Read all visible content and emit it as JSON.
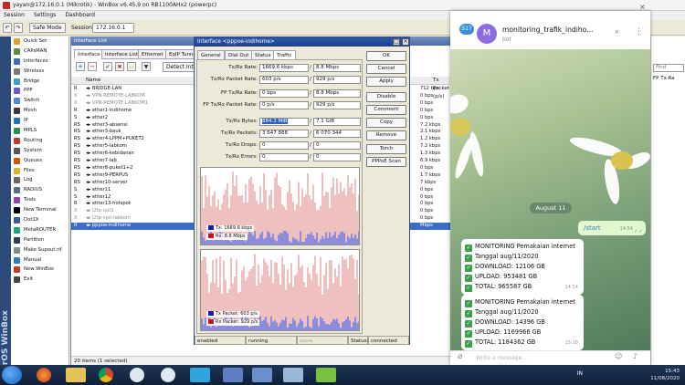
{
  "winbox": {
    "title": "yayan@172.16.0.1 (Mikrotik) - WinBox v6.45.9 on RB1100AHx2 (powerpc)",
    "menu": [
      "Session",
      "Settings",
      "Dashboard"
    ],
    "safe_mode": "Safe Mode",
    "session_label": "Session:",
    "session_value": "172.16.0.1",
    "brand_vertical": "RouterOS WinBox"
  },
  "sidebar": {
    "items": [
      {
        "label": "Quick Set",
        "color": "#d9a22b"
      },
      {
        "label": "CAPsMAN",
        "color": "#5a8f3c"
      },
      {
        "label": "Interfaces",
        "color": "#3a6cc0"
      },
      {
        "label": "Wireless",
        "color": "#7a7a7a"
      },
      {
        "label": "Bridge",
        "color": "#3aa0c8"
      },
      {
        "label": "PPP",
        "color": "#6a5acd"
      },
      {
        "label": "Switch",
        "color": "#4a8bd6"
      },
      {
        "label": "Mesh",
        "color": "#3a3a3a"
      },
      {
        "label": "IP",
        "color": "#1e6fd0"
      },
      {
        "label": "MPLS",
        "color": "#2e8b57"
      },
      {
        "label": "Routing",
        "color": "#c0392b"
      },
      {
        "label": "System",
        "color": "#555555"
      },
      {
        "label": "Queues",
        "color": "#d35400"
      },
      {
        "label": "Files",
        "color": "#e0b030"
      },
      {
        "label": "Log",
        "color": "#666666"
      },
      {
        "label": "RADIUS",
        "color": "#5d6d7e"
      },
      {
        "label": "Tools",
        "color": "#8e44ad"
      },
      {
        "label": "New Terminal",
        "color": "#000000"
      },
      {
        "label": "Dot1X",
        "color": "#3b5998"
      },
      {
        "label": "MetaROUTER",
        "color": "#16a085"
      },
      {
        "label": "Partition",
        "color": "#2c3e50"
      },
      {
        "label": "Make Supout.rif",
        "color": "#7f8c8d"
      },
      {
        "label": "Manual",
        "color": "#2980b9"
      },
      {
        "label": "New WinBox",
        "color": "#c0392b"
      },
      {
        "label": "Exit",
        "color": "#444444"
      }
    ]
  },
  "iflist": {
    "title": "Interface List",
    "tabs": [
      "Interface",
      "Interface List",
      "Ethernet",
      "EoIP Tunnel"
    ],
    "detect_btn": "Detect Inter",
    "col_name": "Name",
    "col_tx": "Tx Packet (p/s)",
    "rows": [
      {
        "flag": "R",
        "name": "BRIDGE-LAN",
        "speed": "712 bps",
        "state": "normal"
      },
      {
        "flag": "X",
        "name": "VPN-REMOTE-LABKOM",
        "speed": "0 bps",
        "state": "dis"
      },
      {
        "flag": "X",
        "name": "VPN-REMOTE-LABKOM1",
        "speed": "0 bps",
        "state": "dis"
      },
      {
        "flag": "R",
        "name": "ether1-indihome",
        "speed": "0 bps",
        "state": "normal"
      },
      {
        "flag": "S",
        "name": "ether2",
        "speed": "0 bps",
        "state": "normal"
      },
      {
        "flag": "RS",
        "name": "ether3-absensi",
        "speed": "7.2 kbps",
        "state": "normal"
      },
      {
        "flag": "RS",
        "name": "ether3-bauk",
        "speed": "2.1 kbps",
        "state": "normal"
      },
      {
        "flag": "RS",
        "name": "ether4-LPPM+PUKET2",
        "speed": "1.2 kbps",
        "state": "normal"
      },
      {
        "flag": "RS",
        "name": "ether5-labkom",
        "speed": "7.2 kbps",
        "state": "normal"
      },
      {
        "flag": "RS",
        "name": "ether6-kebidanan",
        "speed": "1.3 kbps",
        "state": "normal"
      },
      {
        "flag": "RS",
        "name": "ether7-lab",
        "speed": "6.9 kbps",
        "state": "normal"
      },
      {
        "flag": "RS",
        "name": "ether8-puket1+2",
        "speed": "0 bps",
        "state": "normal"
      },
      {
        "flag": "RS",
        "name": "ether9-PERPUS",
        "speed": "1.7 kbps",
        "state": "normal"
      },
      {
        "flag": "RS",
        "name": "ether10-server",
        "speed": "7 kbps",
        "state": "normal"
      },
      {
        "flag": "S",
        "name": "ether11",
        "speed": "0 bps",
        "state": "normal"
      },
      {
        "flag": "S",
        "name": "ether12",
        "speed": "0 bps",
        "state": "normal"
      },
      {
        "flag": "R",
        "name": "ether13-hotspot",
        "speed": "0 bps",
        "state": "normal"
      },
      {
        "flag": "X",
        "name": "l2tp-out1",
        "speed": "0 bps",
        "state": "dis"
      },
      {
        "flag": "X",
        "name": "l2tp-vpn-labkom",
        "speed": "0 bps",
        "state": "dis"
      },
      {
        "flag": "R",
        "name": "pppoe-indihome",
        "speed": "Mbps",
        "state": "sel"
      }
    ],
    "status": "20 items (1 selected)"
  },
  "dialog": {
    "title": "Interface <pppoe-indihome>",
    "tabs": [
      "General",
      "Dial Out",
      "Status",
      "Traffic"
    ],
    "fields": [
      {
        "label": "Tx/Rx Rate:",
        "tx": "1669.6 kbps",
        "rx": "8.8 Mbps"
      },
      {
        "label": "Tx/Rx Packet Rate:",
        "tx": "603 p/s",
        "rx": "929 p/s"
      },
      {
        "label": "FP Tx/Rx Rate:",
        "tx": "0 bps",
        "rx": "8.8 Mbps"
      },
      {
        "label": "FP Tx/Rx Packet Rate:",
        "tx": "0 p/s",
        "rx": "929 p/s"
      },
      {
        "label": "Tx/Rx Bytes:",
        "tx": "884.3 MiB",
        "rx": "7.1 GiB"
      },
      {
        "label": "Tx/Rx Packets:",
        "tx": "3 647 888",
        "rx": "6 070 344"
      },
      {
        "label": "Tx/Rx Drops:",
        "tx": "0",
        "rx": "0"
      },
      {
        "label": "Tx/Rx Errors:",
        "tx": "0",
        "rx": "0"
      }
    ],
    "buttons": [
      "OK",
      "Cancel",
      "Apply",
      "Disable",
      "Comment",
      "Copy",
      "Remove",
      "Torch",
      "PPPoE Scan"
    ],
    "graph1": {
      "tx_label": "Tx:",
      "tx_value": "1669.6 kbps",
      "rx_label": "Rx:",
      "rx_value": "8.8 Mbps",
      "tx_color": "#1a1ab5",
      "rx_color": "#c01717"
    },
    "graph2": {
      "tx_label": "Tx Packet:",
      "tx_value": "603 p/s",
      "rx_label": "Rx Packet:",
      "rx_value": "929 p/s",
      "tx_color": "#1a1ab5",
      "rx_color": "#c01717"
    },
    "status_cells": [
      "enabled",
      "running",
      "slave",
      "Status:",
      "connected"
    ]
  },
  "telegram": {
    "back_count": "517",
    "avatar_letter": "M",
    "name": "monitoring_trafik_indiho...",
    "subtitle": "bot",
    "date_chip": "August 11",
    "outgoing": {
      "text": "/start",
      "time": "14:54"
    },
    "messages": [
      {
        "lines": [
          "MONITORING Pemakaian internet",
          "Tanggal aug/11/2020",
          "DOWNLOAD: 12106 GB",
          "UPLOAD: 953481 GB",
          "TOTAL: 965587 GB"
        ],
        "time": "14:54"
      },
      {
        "lines": [
          "MONITORING Pemakaian internet",
          "Tanggal aug/11/2020",
          "DOWNLOAD: 14396 GB",
          "UPLOAD: 1169966 GB",
          "TOTAL: 1184362 GB"
        ],
        "time": "15:10"
      }
    ],
    "input_placeholder": "Write a message..."
  },
  "rpanel": {
    "find": "Find",
    "col": "FP Tx Ra"
  },
  "taskbar": {
    "lang": "IN",
    "time": "15:43",
    "date": "11/08/2020"
  }
}
